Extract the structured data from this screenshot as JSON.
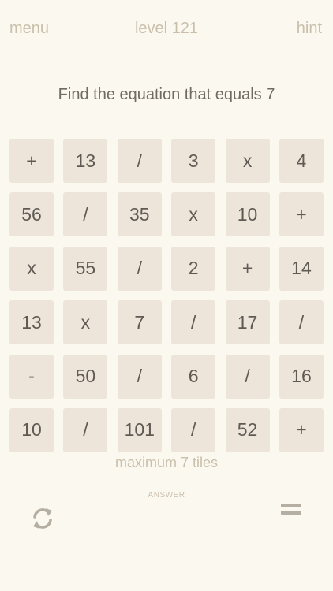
{
  "header": {
    "menu_label": "menu",
    "level_label": "level 121",
    "hint_label": "hint"
  },
  "instruction": "Find the equation that equals 7",
  "tiles": [
    "+",
    "13",
    "/",
    "3",
    "x",
    "4",
    "56",
    "/",
    "35",
    "x",
    "10",
    "+",
    "x",
    "55",
    "/",
    "2",
    "+",
    "14",
    "13",
    "x",
    "7",
    "/",
    "17",
    "/",
    "-",
    "50",
    "/",
    "6",
    "/",
    "16",
    "10",
    "/",
    "101",
    "/",
    "52",
    "+"
  ],
  "max_tiles_label": "maximum 7 tiles",
  "answer_label": "ANSWER",
  "icons": {
    "refresh": "refresh-icon",
    "equals": "equals-icon"
  },
  "colors": {
    "background": "#fbf8ef",
    "tile": "#eee5da",
    "tile_text": "#5f5a53",
    "muted_text": "#c9bfab",
    "icon": "#b5aea2"
  }
}
